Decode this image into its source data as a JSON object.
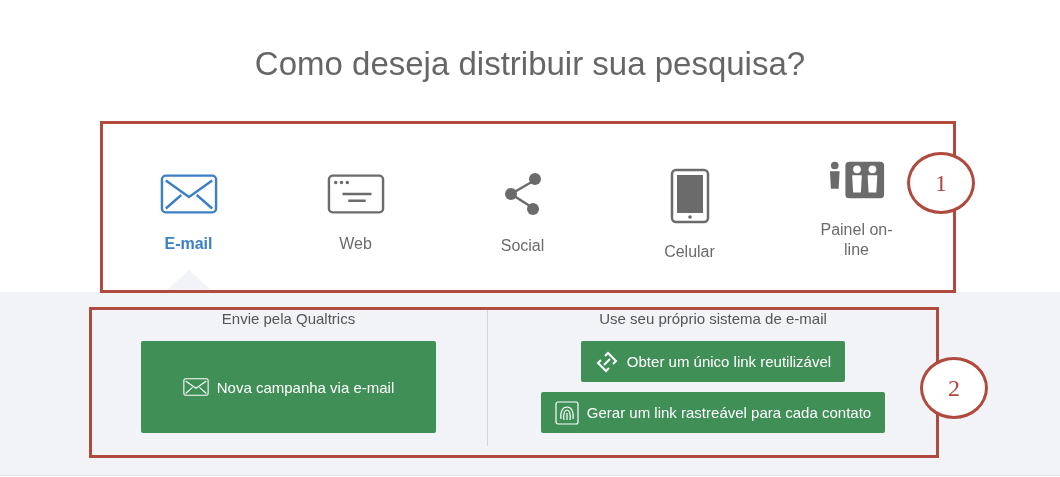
{
  "title": "Como deseja distribuir sua pesquisa?",
  "channels": [
    {
      "label": "E-mail",
      "kind": "envelope",
      "selected": true
    },
    {
      "label": "Web",
      "kind": "browser",
      "selected": false
    },
    {
      "label": "Social",
      "kind": "share",
      "selected": false
    },
    {
      "label": "Celular",
      "kind": "tablet",
      "selected": false
    },
    {
      "label": "Painel on-line",
      "kind": "people",
      "selected": false
    }
  ],
  "sections": [
    {
      "heading": "Envie pela Qualtrics",
      "buttons": [
        {
          "label": "Nova campanha via e-mail",
          "kind": "envelope"
        }
      ]
    },
    {
      "heading": "Use seu próprio sistema de e-mail",
      "buttons": [
        {
          "label": "Obter um único link reutilizável",
          "kind": "link"
        },
        {
          "label": "Gerar um link rastreável para cada contato",
          "kind": "fingerprint"
        }
      ]
    }
  ],
  "annotations": [
    "1",
    "2"
  ]
}
